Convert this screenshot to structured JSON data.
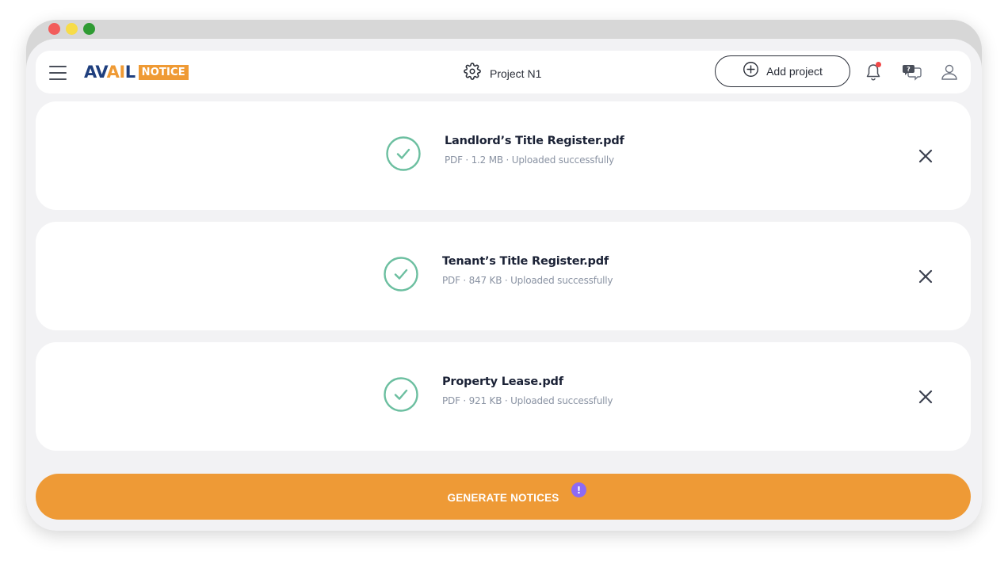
{
  "header": {
    "logo_main": "AVAIL",
    "logo_tag": "NOTICE",
    "project_name": "Project N1",
    "add_project_label": "Add project"
  },
  "files": [
    {
      "name": "Landlord’s Title Register.pdf",
      "meta": "PDF · 1.2 MB · Uploaded successfully"
    },
    {
      "name": "Tenant’s Title Register.pdf",
      "meta": "PDF · 847 KB · Uploaded successfully"
    },
    {
      "name": "Property Lease.pdf",
      "meta": "PDF · 921 KB · Uploaded successfully"
    }
  ],
  "actions": {
    "generate_label": "GENERATE NOTICES",
    "warning_badge": "!"
  },
  "icons": {
    "menu": "hamburger-menu-icon",
    "settings": "gear-icon",
    "add": "plus-circle-icon",
    "notifications": "bell-icon",
    "chat": "chat-question-icon",
    "user": "user-icon",
    "file_status": "check-circle-icon",
    "remove": "close-icon"
  },
  "colors": {
    "brand_navy": "#1f3f7e",
    "brand_orange": "#ef9a34",
    "success_green": "#6cbfa0",
    "notification_dot": "#f24848",
    "warning_purple": "#8d6af4"
  }
}
